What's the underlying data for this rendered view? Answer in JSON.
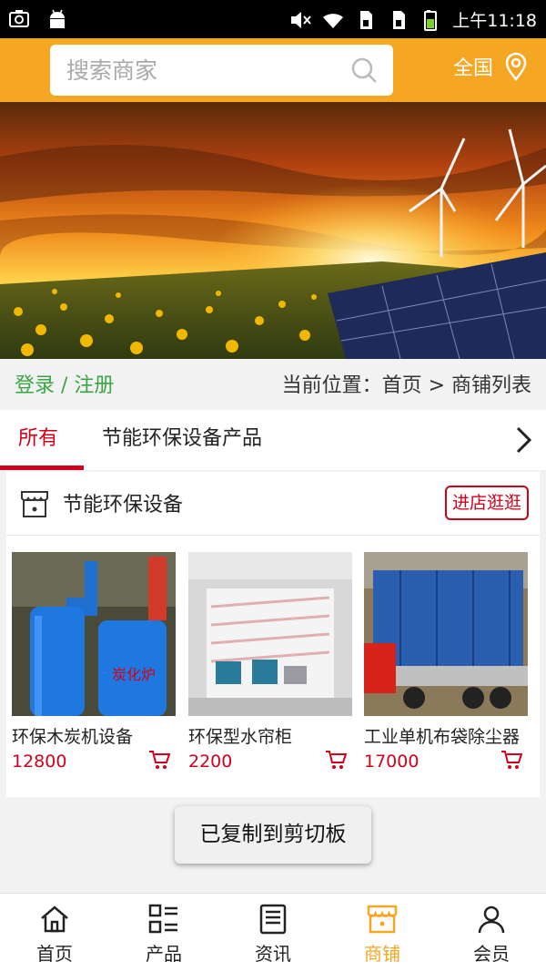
{
  "status_bar": {
    "time": "上午11:18"
  },
  "header": {
    "search_placeholder": "搜索商家",
    "region_label": "全国"
  },
  "crumbs": {
    "login": "登录 / 注册",
    "location": "当前位置：首页 > 商铺列表"
  },
  "tabs": [
    {
      "label": "所有",
      "active": true
    },
    {
      "label": "节能环保设备产品",
      "active": false
    }
  ],
  "shop": {
    "name": "节能环保设备",
    "visit_label": "进店逛逛",
    "products": [
      {
        "name": "环保木炭机设备",
        "price": "12800"
      },
      {
        "name": "环保型水帘柜",
        "price": "2200"
      },
      {
        "name": "工业单机布袋除尘器",
        "price": "17000"
      }
    ]
  },
  "toast": "已复制到剪切板",
  "bottom_nav": [
    {
      "label": "首页",
      "icon": "home-icon",
      "active": false
    },
    {
      "label": "产品",
      "icon": "grid-list-icon",
      "active": false
    },
    {
      "label": "资讯",
      "icon": "news-icon",
      "active": false
    },
    {
      "label": "商铺",
      "icon": "shop-icon",
      "active": true
    },
    {
      "label": "会员",
      "icon": "user-icon",
      "active": false
    }
  ],
  "colors": {
    "accent": "#f5a623",
    "red": "#d0021b",
    "green": "#3aa543"
  }
}
